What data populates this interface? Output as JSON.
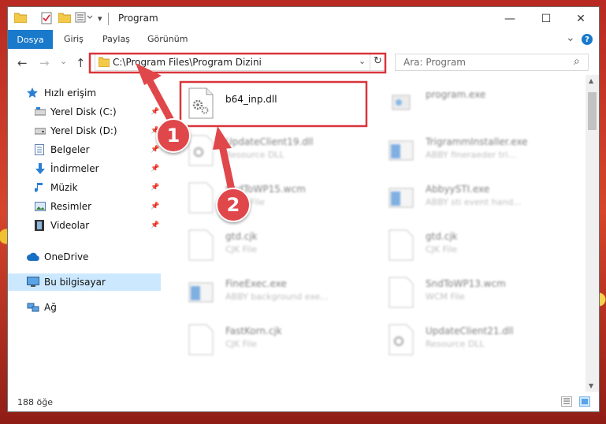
{
  "window": {
    "title": "Program",
    "controls": {
      "minimize": "—",
      "maximize": "☐",
      "close": "✕"
    }
  },
  "ribbon": {
    "tabs": [
      "Dosya",
      "Giriş",
      "Paylaş",
      "Görünüm"
    ],
    "expand": "⌄",
    "help": "?"
  },
  "nav": {
    "back": "←",
    "forward": "→",
    "recent": "⌄",
    "up": "↑",
    "address": "C:\\Program Files\\Program Dizini",
    "dropdown": "⌄",
    "refresh": "↻",
    "search_placeholder": "Ara: Program",
    "search_icon": "⌕"
  },
  "sidebar": {
    "items": [
      {
        "label": "Hızlı erişim",
        "icon": "star-icon",
        "pinned": false
      },
      {
        "label": "Yerel Disk (C:)",
        "icon": "drive-icon",
        "pinned": true
      },
      {
        "label": "Yerel Disk (D:)",
        "icon": "drive-icon",
        "pinned": true
      },
      {
        "label": "Belgeler",
        "icon": "documents-icon",
        "pinned": true
      },
      {
        "label": "İndirmeler",
        "icon": "download-icon",
        "pinned": true
      },
      {
        "label": "Müzik",
        "icon": "music-icon",
        "pinned": true
      },
      {
        "label": "Resimler",
        "icon": "pictures-icon",
        "pinned": true
      },
      {
        "label": "Videolar",
        "icon": "videos-icon",
        "pinned": true
      },
      {
        "label": "OneDrive",
        "icon": "cloud-icon",
        "pinned": false
      },
      {
        "label": "Bu bilgisayar",
        "icon": "computer-icon",
        "pinned": false
      },
      {
        "label": "Ağ",
        "icon": "network-icon",
        "pinned": false
      }
    ],
    "pin_glyph": "📌"
  },
  "files": [
    {
      "name": "b64_inp.dll",
      "type": "",
      "icon": "dll-gear-icon",
      "highlighted": true
    },
    {
      "name": "program.exe",
      "type": "",
      "icon": "exe-icon"
    },
    {
      "name": "UpdateClient19.dll",
      "type": "Resource DLL",
      "icon": "dll-gear-icon"
    },
    {
      "name": "TrigrammInstaller.exe",
      "type": "ABBY fineraeder tri...",
      "icon": "exe-window-icon"
    },
    {
      "name": "SndToWP15.wcm",
      "type": "WCM File",
      "icon": "file-icon"
    },
    {
      "name": "AbbyySTI.exe",
      "type": "ABBY sti event hand...",
      "icon": "exe-window-icon"
    },
    {
      "name": "gtd.cjk",
      "type": "CJK File",
      "icon": "file-icon"
    },
    {
      "name": "gtd.cjk",
      "type": "CJK File",
      "icon": "file-icon"
    },
    {
      "name": "FineExec.exe",
      "type": "ABBY background exe...",
      "icon": "exe-window-icon"
    },
    {
      "name": "SndToWP13.wcm",
      "type": "WCM File",
      "icon": "file-icon"
    },
    {
      "name": "FastKorn.cjk",
      "type": "CJK File",
      "icon": "file-icon"
    },
    {
      "name": "UpdateClient21.dll",
      "type": "Resource DLL",
      "icon": "dll-gear-icon"
    }
  ],
  "status": {
    "count": "188 öğe"
  },
  "annotations": {
    "step1": "1",
    "step2": "2"
  },
  "colors": {
    "accent": "#1979ca",
    "highlight_box": "#d9343b",
    "arrow": "#e0474b",
    "selection": "#cce8ff"
  }
}
